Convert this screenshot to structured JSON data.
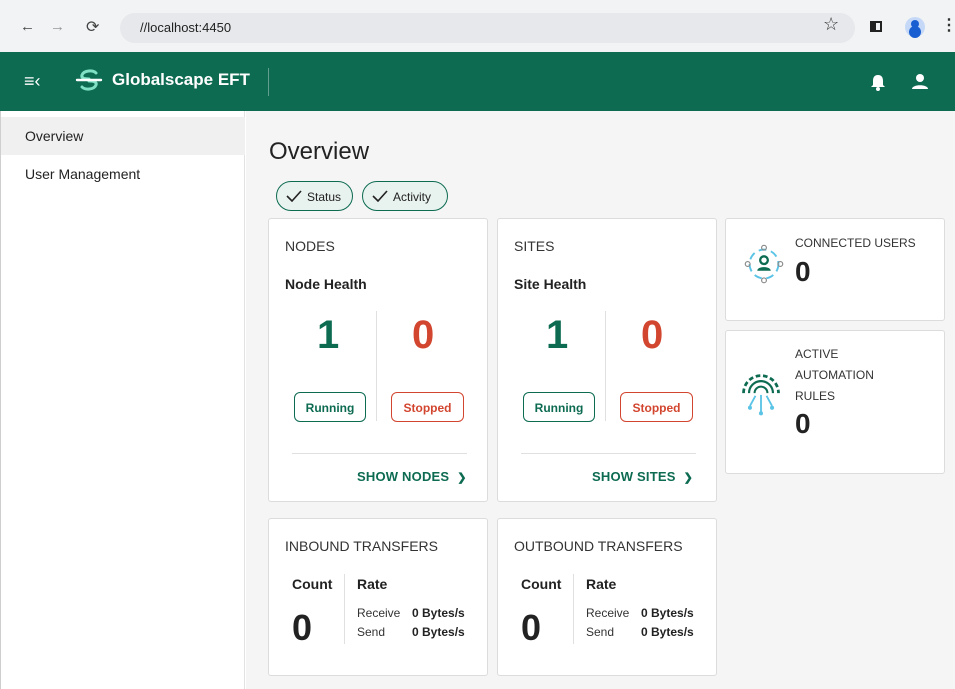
{
  "browser": {
    "url": "//localhost:4450",
    "back_icon": "arrow-left-icon",
    "forward_icon": "arrow-right-icon",
    "reload_icon": "reload-icon"
  },
  "app": {
    "title": "Globalscape EFT",
    "brand_color": "#0d6b52"
  },
  "sidebar": {
    "items": [
      {
        "label": "Overview",
        "active": true
      },
      {
        "label": "User Management",
        "active": false
      }
    ]
  },
  "page": {
    "title": "Overview",
    "filters": [
      {
        "label": "Status",
        "checked": true
      },
      {
        "label": "Activity",
        "checked": true
      }
    ]
  },
  "nodes": {
    "title": "NODES",
    "subtitle": "Node Health",
    "running_count": "1",
    "stopped_count": "0",
    "running_label": "Running",
    "stopped_label": "Stopped",
    "show_label": "SHOW NODES"
  },
  "sites": {
    "title": "SITES",
    "subtitle": "Site Health",
    "running_count": "1",
    "stopped_count": "0",
    "running_label": "Running",
    "stopped_label": "Stopped",
    "show_label": "SHOW SITES"
  },
  "connected_users": {
    "title": "CONNECTED USERS",
    "value": "0"
  },
  "automation": {
    "title_lines": [
      "ACTIVE",
      "AUTOMATION",
      "RULES"
    ],
    "value": "0"
  },
  "inbound": {
    "title": "INBOUND TRANSFERS",
    "count_label": "Count",
    "rate_label": "Rate",
    "count": "0",
    "receive_label": "Receive",
    "receive_value": "0 Bytes/s",
    "send_label": "Send",
    "send_value": "0 Bytes/s"
  },
  "outbound": {
    "title": "OUTBOUND TRANSFERS",
    "count_label": "Count",
    "rate_label": "Rate",
    "count": "0",
    "receive_label": "Receive",
    "receive_value": "0 Bytes/s",
    "send_label": "Send",
    "send_value": "0 Bytes/s"
  }
}
